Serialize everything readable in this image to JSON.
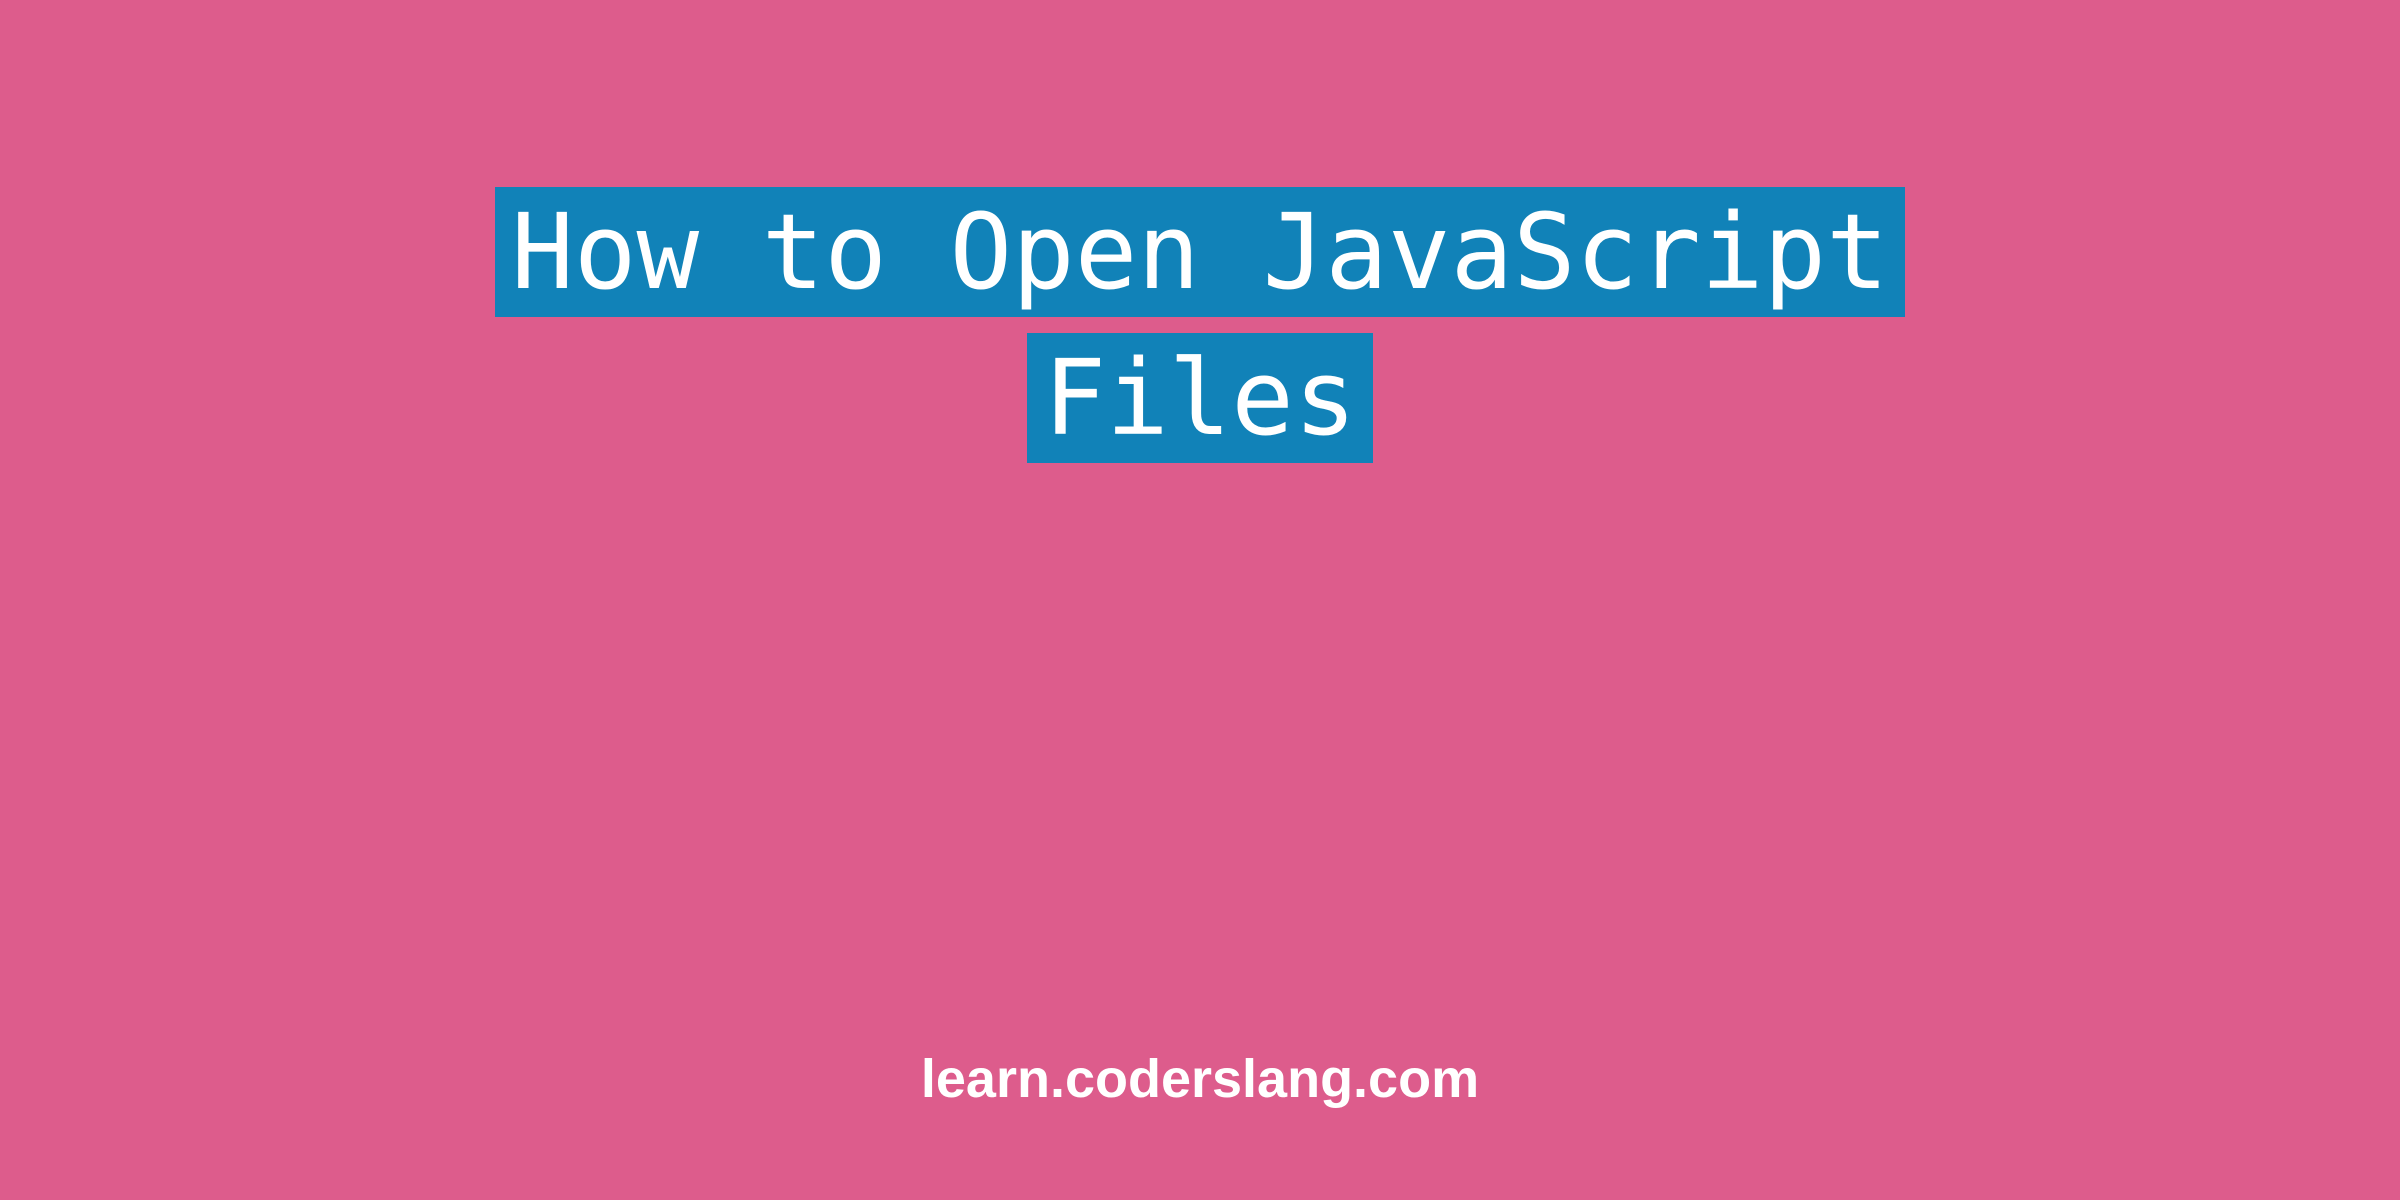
{
  "title": {
    "line1": "How to Open JavaScript",
    "line2": "Files"
  },
  "footer": "learn.coderslang.com",
  "colors": {
    "background": "#dd5c8c",
    "highlight": "#1182b8",
    "text": "#ffffff"
  }
}
